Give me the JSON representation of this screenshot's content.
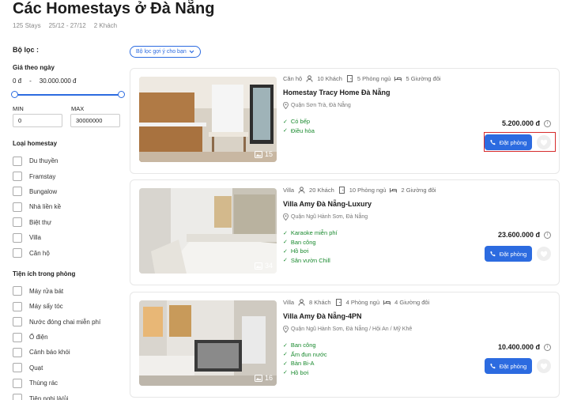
{
  "header": {
    "title": "Các Homestays ở Đà Nẵng",
    "stays": "125 Stays",
    "dates": "25/12 - 27/12",
    "guests": "2 Khách"
  },
  "filters": {
    "title": "Bộ lọc :",
    "price": {
      "label": "Giá theo ngày",
      "range_min": "0 đ",
      "dash": "-",
      "range_max": "30.000.000 đ",
      "min_label": "MIN",
      "max_label": "MAX",
      "min_value": "0",
      "max_value": "30000000"
    },
    "types": {
      "label": "Loại homestay",
      "items": [
        "Du thuyền",
        "Framstay",
        "Bungalow",
        "Nhà liền kề",
        "Biệt thự",
        "Villa",
        "Căn hộ"
      ]
    },
    "amenities": {
      "label": "Tiện ích trong phòng",
      "items": [
        "Máy rửa bát",
        "Máy sấy tóc",
        "Nước đóng chai miễn phí",
        "Ổ điện",
        "Cảnh báo khói",
        "Quạt",
        "Thùng rác",
        "Tiện nghi là/ủi"
      ]
    }
  },
  "suggest_button": "Bộ lọc gợi ý cho bạn",
  "listings": [
    {
      "type": "Căn hộ",
      "guests": "10 Khách",
      "bedrooms": "5 Phòng ngủ",
      "beds": "5 Giường đôi",
      "name": "Homestay Tracy Home Đà Nẵng",
      "location": "Quận Sơn Trà, Đà Nẵng",
      "amenities": [
        "Có bếp",
        "Điều hòa"
      ],
      "price": "5.200.000 đ",
      "image_count": "15",
      "book_label": "Đặt phòng"
    },
    {
      "type": "Villa",
      "guests": "20 Khách",
      "bedrooms": "10 Phòng ngủ",
      "beds": "2 Giường đôi",
      "name": "Villa Amy Đà Nẵng-Luxury",
      "location": "Quận Ngũ Hành Sơn, Đà Nẵng",
      "amenities": [
        "Karaoke miễn phí",
        "Ban công",
        "Hồ bơi",
        "Sân vườn Chill"
      ],
      "price": "23.600.000 đ",
      "image_count": "34",
      "book_label": "Đặt phòng"
    },
    {
      "type": "Villa",
      "guests": "8 Khách",
      "bedrooms": "4 Phòng ngủ",
      "beds": "4 Giường đôi",
      "name": "Villa Amy Đà Nẵng-4PN",
      "location": "Quận Ngũ Hành Sơn, Đà Nẵng / Hội An / Mỹ Khê",
      "amenities": [
        "Ban công",
        "Ấm đun nước",
        "Bàn Bi-A",
        "Hồ bơi"
      ],
      "price": "10.400.000 đ",
      "image_count": "16",
      "book_label": "Đặt phòng"
    }
  ],
  "colors": {
    "accent": "#2c6be0",
    "amenity_green": "#1a8a2f",
    "highlight": "#d62b2b"
  }
}
